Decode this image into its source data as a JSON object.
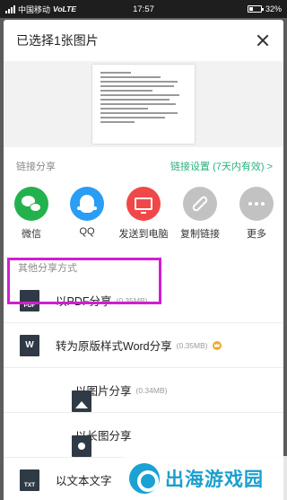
{
  "status_bar": {
    "carrier": "中国移动",
    "network": "VoLTE",
    "time": "17:57",
    "battery": "32%"
  },
  "sheet": {
    "title": "已选择1张图片",
    "link_share_label": "链接分享",
    "link_settings": "链接设置 (7天内有效) >",
    "other_methods_label": "其他分享方式"
  },
  "share_targets": [
    {
      "label": "微信",
      "icon": "wechat-icon",
      "color": "#23b14d"
    },
    {
      "label": "QQ",
      "icon": "qq-icon",
      "color": "#2a9df4"
    },
    {
      "label": "发送到电脑",
      "icon": "computer-icon",
      "color": "#f04848"
    },
    {
      "label": "复制链接",
      "icon": "link-icon",
      "color": "#c2c2c2"
    },
    {
      "label": "更多",
      "icon": "more-icon",
      "color": "#c2c2c2"
    }
  ],
  "options": [
    {
      "title": "以PDF分享",
      "size": "(0.35MB)",
      "icon": "pdf-icon",
      "icon_text": "PDF"
    },
    {
      "title": "转为原版样式Word分享",
      "size": "(0.35MB)",
      "icon": "word-icon",
      "icon_text": "W"
    },
    {
      "title": "以图片分享",
      "size": "(0.34MB)",
      "icon": "image-icon"
    },
    {
      "title": "以长图分享",
      "size": "",
      "icon": "long-image-icon"
    },
    {
      "title": "以文本文字",
      "size": "",
      "icon": "txt-icon",
      "icon_text": "TXT"
    }
  ],
  "watermark": {
    "text": "出海游戏园"
  }
}
